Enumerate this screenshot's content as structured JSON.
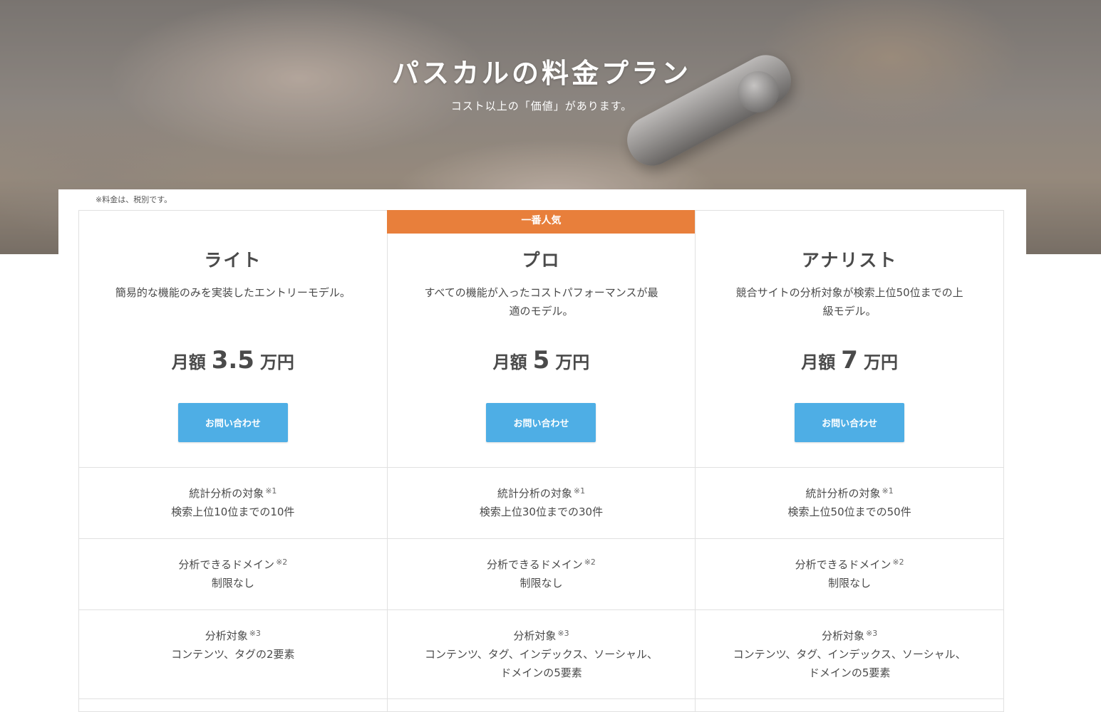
{
  "hero": {
    "title": "パスカルの料金プラン",
    "subtitle": "コスト以上の「価値」があります。"
  },
  "tax_note": "※料金は、税別です。",
  "colors": {
    "badge": "#e87f3b",
    "button": "#4eaee5",
    "text": "#4a4a4a",
    "border": "#e1e1e1"
  },
  "plans": [
    {
      "badge": "",
      "name": "ライト",
      "description": "簡易的な機能のみを実装したエントリーモデル。",
      "price_label": "月額",
      "price_amount": "3.5",
      "price_unit": "万円",
      "button": "お問い合わせ",
      "features": [
        {
          "title": "統計分析の対象",
          "note": "※1",
          "value": "検索上位10位までの10件"
        },
        {
          "title": "分析できるドメイン",
          "note": "※2",
          "value": "制限なし"
        },
        {
          "title": "分析対象",
          "note": "※3",
          "value": "コンテンツ、タグの2要素"
        }
      ]
    },
    {
      "badge": "一番人気",
      "name": "プロ",
      "description": "すべての機能が入ったコストパフォーマンスが最適のモデル。",
      "price_label": "月額",
      "price_amount": "5",
      "price_unit": "万円",
      "button": "お問い合わせ",
      "features": [
        {
          "title": "統計分析の対象",
          "note": "※1",
          "value": "検索上位30位までの30件"
        },
        {
          "title": "分析できるドメイン",
          "note": "※2",
          "value": "制限なし"
        },
        {
          "title": "分析対象",
          "note": "※3",
          "value": "コンテンツ、タグ、インデックス、ソーシャル、ドメインの5要素"
        }
      ]
    },
    {
      "badge": "",
      "name": "アナリスト",
      "description": "競合サイトの分析対象が検索上位50位までの上級モデル。",
      "price_label": "月額",
      "price_amount": "7",
      "price_unit": "万円",
      "button": "お問い合わせ",
      "features": [
        {
          "title": "統計分析の対象",
          "note": "※1",
          "value": "検索上位50位までの50件"
        },
        {
          "title": "分析できるドメイン",
          "note": "※2",
          "value": "制限なし"
        },
        {
          "title": "分析対象",
          "note": "※3",
          "value": "コンテンツ、タグ、インデックス、ソーシャル、ドメインの5要素"
        }
      ]
    }
  ]
}
